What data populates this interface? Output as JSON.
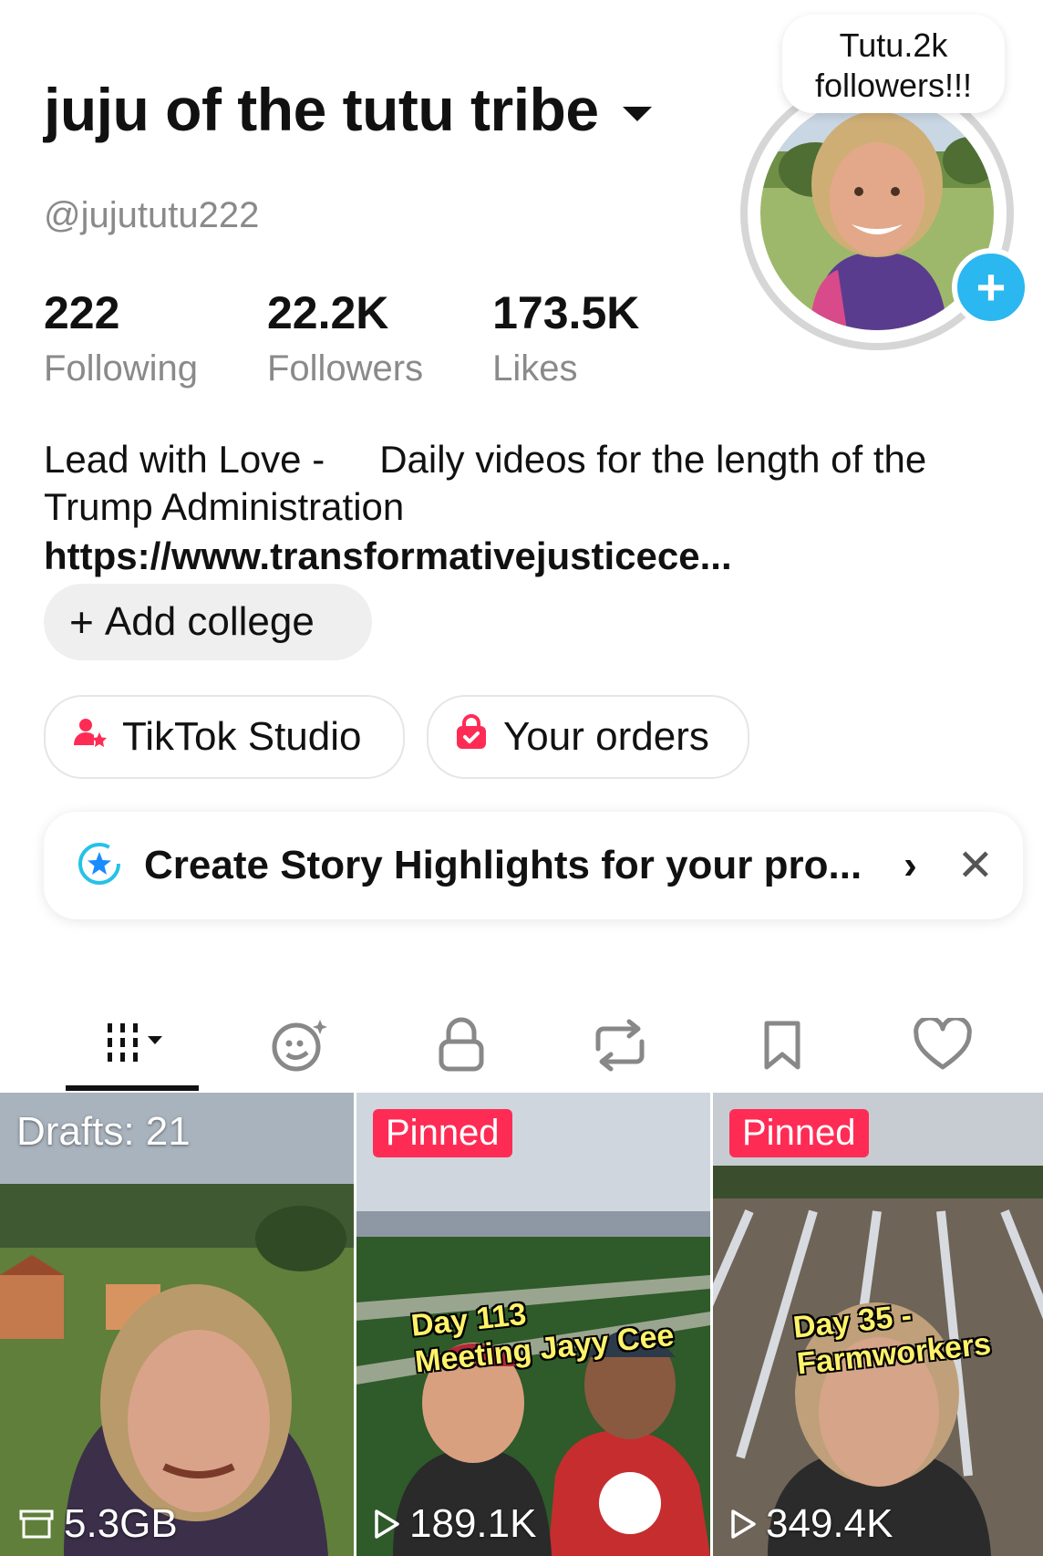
{
  "profile": {
    "display_name": "juju of the tutu tribe",
    "handle": "@jujututu222",
    "bubble_note": "Tutu.2k followers!!!",
    "stats": [
      {
        "value": "222",
        "label": "Following"
      },
      {
        "value": "22.2K",
        "label": "Followers"
      },
      {
        "value": "173.5K",
        "label": "Likes"
      }
    ],
    "bio_part1": "Lead with Love -",
    "bio_part2": "Daily videos for the length of the Trump Administration",
    "link": "https://www.transformativejusticece..."
  },
  "buttons": {
    "add_college": "Add college",
    "tiktok_studio": "TikTok Studio",
    "your_orders": "Your orders"
  },
  "story_banner": {
    "text": "Create Story Highlights for your pro..."
  },
  "tabs": [
    {
      "icon": "videos-grid-icon",
      "selected": true
    },
    {
      "icon": "ai-self-icon",
      "selected": false
    },
    {
      "icon": "lock-icon",
      "selected": false
    },
    {
      "icon": "repost-icon",
      "selected": false
    },
    {
      "icon": "bookmark-icon",
      "selected": false
    },
    {
      "icon": "heart-icon",
      "selected": false
    }
  ],
  "videos": [
    {
      "top_label": "Drafts: 21",
      "bottom_label": "5.3GB",
      "caption": ""
    },
    {
      "top_label": "Pinned",
      "bottom_label": "189.1K",
      "caption_line1": "Day 113",
      "caption_line2": "Meeting Jayy Cee"
    },
    {
      "top_label": "Pinned",
      "bottom_label": "349.4K",
      "caption_line1": "Day 35 -",
      "caption_line2": "Farmworkers"
    }
  ],
  "colors": {
    "accent_red": "#fe2c55",
    "follow_blue": "#2bb7f0",
    "muted_text": "#8a8a8a"
  }
}
